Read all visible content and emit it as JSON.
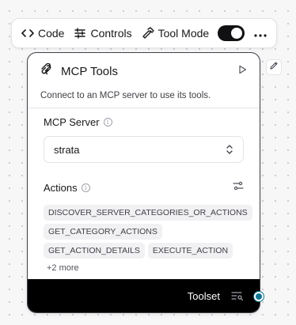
{
  "toolbar": {
    "code_label": "Code",
    "controls_label": "Controls",
    "tool_mode_label": "Tool Mode",
    "tool_mode_enabled": true
  },
  "node": {
    "title": "MCP Tools",
    "description": "Connect to an MCP server to use its tools.",
    "mcp_server": {
      "label": "MCP Server",
      "value": "strata"
    },
    "actions": {
      "label": "Actions",
      "items": [
        "DISCOVER_SERVER_CATEGORIES_OR_ACTIONS",
        "GET_CATEGORY_ACTIONS",
        "GET_ACTION_DETAILS",
        "EXECUTE_ACTION"
      ],
      "more_label": "+2 more"
    },
    "footer": {
      "label": "Toolset"
    }
  },
  "colors": {
    "handle": "#0e7490",
    "footer_bg": "#000000",
    "toggle_on": "#111113"
  },
  "icons": {
    "code": "code-icon",
    "controls": "sliders-icon",
    "tool_mode": "hammer-icon",
    "more": "more-horizontal-icon",
    "node": "mcp-icon",
    "run": "play-icon",
    "edit": "pencil-icon",
    "info": "info-icon",
    "select": "chevrons-up-down-icon",
    "filter": "settings-sliders-icon",
    "toolset": "list-search-icon"
  }
}
